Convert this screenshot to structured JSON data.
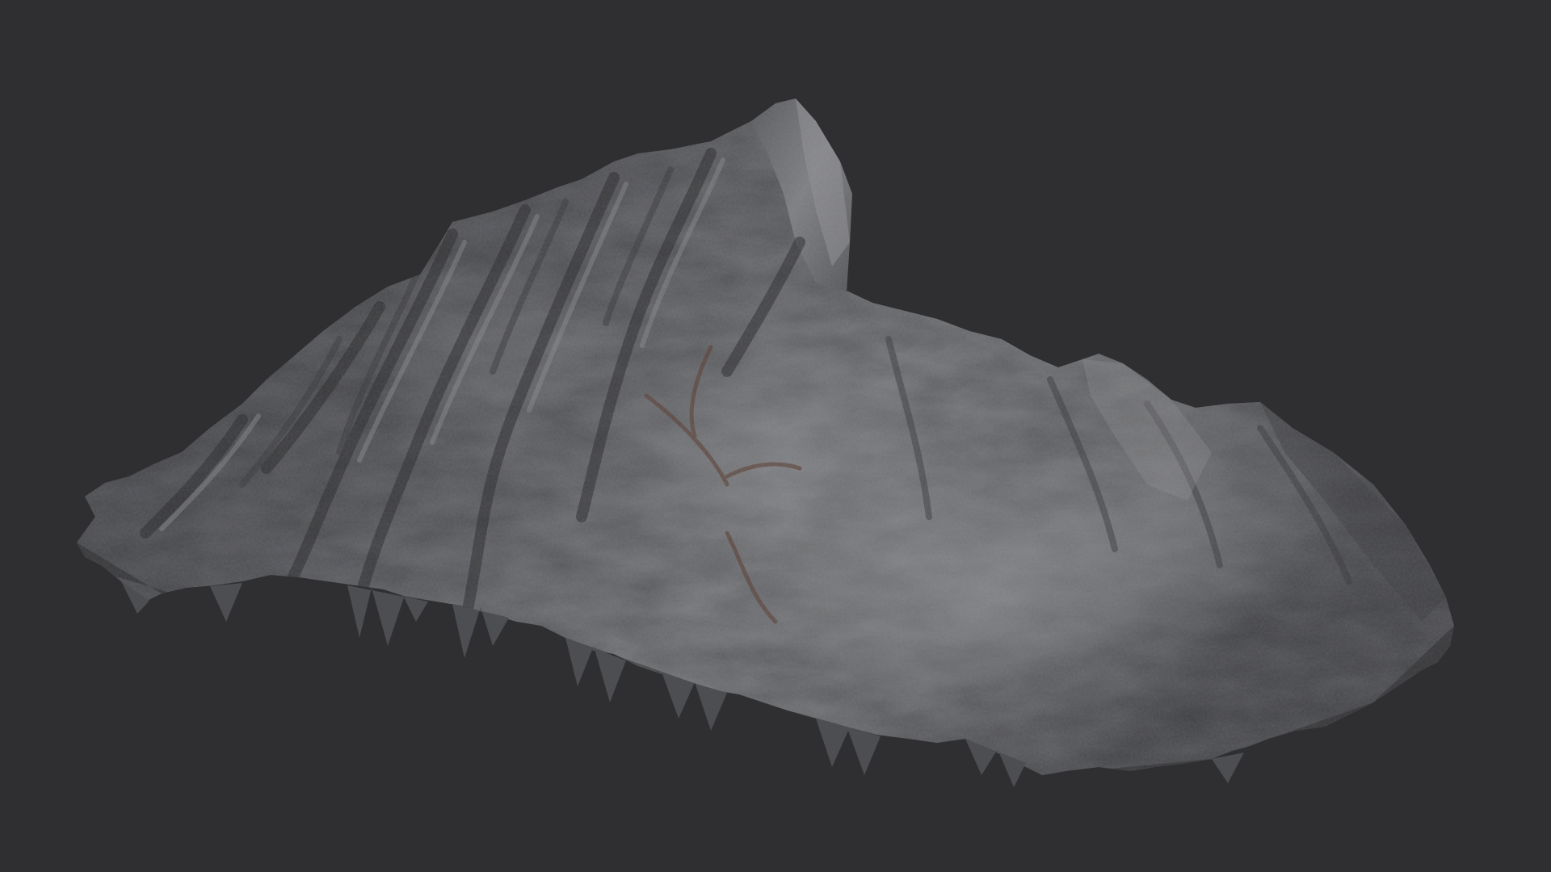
{
  "scene": {
    "subject": "rock-terrain-model",
    "colors": {
      "background": "#2f2f31",
      "rock_light": "#8e8f92",
      "rock_mid": "#6a6b6e",
      "rock_dark": "#2b2b2e",
      "rust_accent": "#5a3e33"
    }
  }
}
